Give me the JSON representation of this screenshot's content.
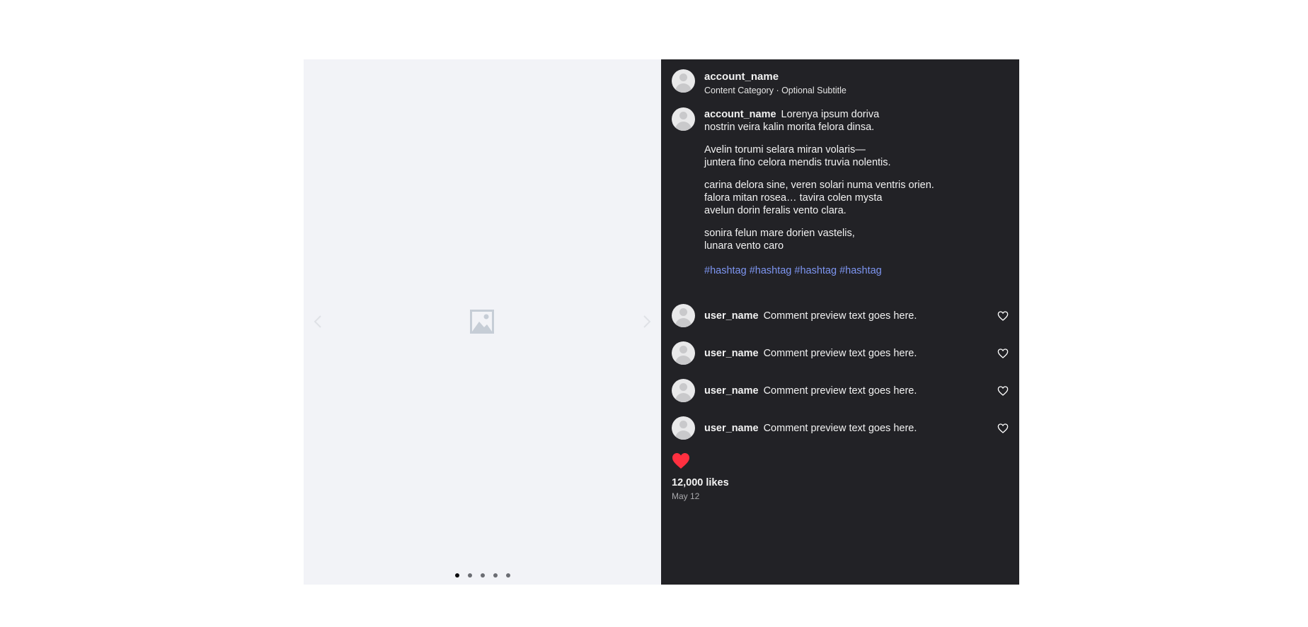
{
  "account_name": "account_name",
  "subtitle": "Content Category · Optional Subtitle",
  "caption": {
    "lines_1": [
      "Lorenya ipsum doriva",
      "nostrin veira kalin morita felora dinsa."
    ],
    "para_2": [
      "Avelin torumi selara miran volaris—",
      "juntera fino celora mendis truvia nolentis."
    ],
    "para_3": [
      "carina delora sine, veren solari numa ventris orien.",
      "falora mitan rosea… tavira colen mysta",
      "avelun dorin feralis vento clara."
    ],
    "para_4": [
      "sonira felun mare dorien vastelis,",
      "lunara vento caro"
    ],
    "hashtags": "#hashtag #hashtag #hashtag #hashtag"
  },
  "comments": [
    {
      "user": "user_name",
      "text": "Comment preview text goes here."
    },
    {
      "user": "user_name",
      "text": "Comment preview text goes here."
    },
    {
      "user": "user_name",
      "text": "Comment preview text goes here."
    },
    {
      "user": "user_name",
      "text": "Comment preview text goes here."
    }
  ],
  "likes": "12,000 likes",
  "date": "May 12",
  "carousel": {
    "count": 5,
    "active_index": 0
  },
  "colors": {
    "accent_like": "#ff3040",
    "hashtag": "#7d95f0",
    "panel_bg": "#222226",
    "media_bg": "#f2f3f7"
  },
  "icons": [
    "image-placeholder-icon",
    "chevron-left-icon",
    "chevron-right-icon",
    "heart-outline-icon",
    "heart-filled-icon",
    "avatar-icon"
  ]
}
